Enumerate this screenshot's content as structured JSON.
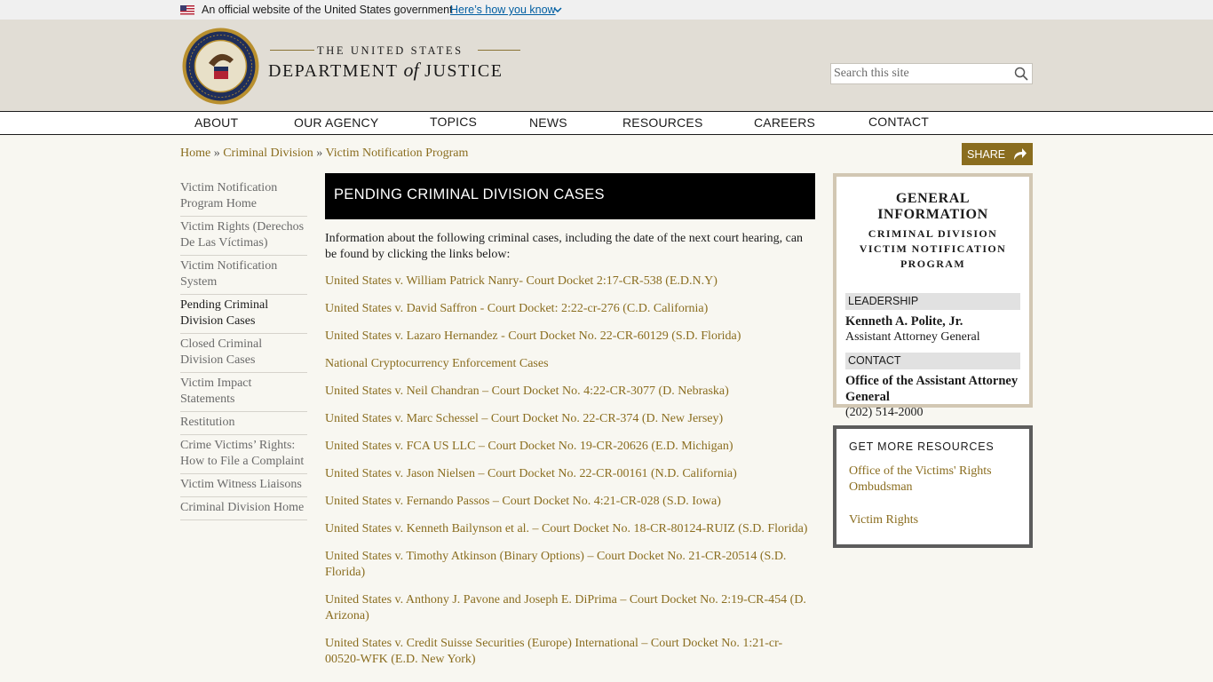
{
  "gov_banner": {
    "official_text": "An official website of the United States government",
    "how_link": "Here’s how you know"
  },
  "header": {
    "united_states": "THE UNITED STATES",
    "department_pre": "DEPARTMENT ",
    "department_of": "of",
    "department_post": " JUSTICE",
    "search_placeholder": "Search this site"
  },
  "nav": {
    "items": [
      {
        "label": "ABOUT"
      },
      {
        "label": "OUR AGENCY"
      },
      {
        "label": "TOPICS"
      },
      {
        "label": "NEWS"
      },
      {
        "label": "RESOURCES"
      },
      {
        "label": "CAREERS"
      },
      {
        "label": "CONTACT"
      }
    ]
  },
  "breadcrumb": {
    "items": [
      "Home",
      "Criminal Division",
      "Victim Notification Program"
    ],
    "separator": "»"
  },
  "share_label": "SHARE",
  "sidebar": {
    "items": [
      {
        "label": "Victim Notification Program Home"
      },
      {
        "label": "Victim Rights (Derechos De Las Víctimas)"
      },
      {
        "label": "Victim Notification System"
      },
      {
        "label": "Pending Criminal Division Cases"
      },
      {
        "label": "Closed Criminal Division Cases"
      },
      {
        "label": "Victim Impact Statements"
      },
      {
        "label": "Restitution"
      },
      {
        "label": "Crime Victims’ Rights: How to File a Complaint"
      },
      {
        "label": "Victim Witness Liaisons"
      },
      {
        "label": "Criminal Division Home"
      }
    ]
  },
  "main": {
    "title": "PENDING CRIMINAL DIVISION CASES",
    "intro": "Information about the following criminal cases, including the date of the next court hearing, can be found by clicking the links below:",
    "cases": [
      "United States v. William Patrick Nanry- Court Docket 2:17-CR-538 (E.D.N.Y)",
      "United States v. David Saffron - Court Docket: 2:22-cr-276 (C.D. California)",
      "United States v. Lazaro Hernandez - Court Docket No. 22-CR-60129 (S.D. Florida)",
      "National Cryptocurrency Enforcement Cases",
      "United States v. Neil Chandran – Court Docket No. 4:22-CR-3077 (D. Nebraska)",
      "United States v. Marc Schessel – Court Docket No. 22-CR-374 (D. New Jersey)",
      "United States v. FCA US LLC – Court Docket No. 19-CR-20626 (E.D. Michigan)",
      "United States v. Jason Nielsen – Court Docket No. 22-CR-00161 (N.D. California)",
      "United States v. Fernando Passos – Court Docket No. 4:21-CR-028 (S.D. Iowa)",
      "United States v. Kenneth Bailynson et al. – Court Docket No. 18-CR-80124-RUIZ (S.D. Florida)",
      "United States v. Timothy Atkinson (Binary Options) – Court Docket No. 21-CR-20514 (S.D. Florida)",
      "United States v. Anthony J. Pavone and Joseph E. DiPrima – Court Docket No. 2:19-CR-454 (D. Arizona)",
      "United States v. Credit Suisse Securities (Europe) International – Court Docket No. 1:21-cr-00520-WFK (E.D. New York)"
    ]
  },
  "info_box": {
    "title": "GENERAL INFORMATION",
    "subtitle": "CRIMINAL DIVISION VICTIM NOTIFICATION PROGRAM",
    "leadership_label": "LEADERSHIP",
    "leader_name": "Kenneth A. Polite, Jr.",
    "leader_role": "Assistant Attorney General",
    "contact_label": "CONTACT",
    "contact_name": "Office of the Assistant Attorney General",
    "contact_phone": "(202) 514-2000"
  },
  "resources": {
    "title": "GET MORE RESOURCES",
    "links": [
      "Office of the Victims' Rights Ombudsman",
      "Victim Rights"
    ]
  },
  "colors": {
    "link_gold": "#8a6d1f",
    "header_bg": "#e1ddd5",
    "page_bg": "#f8f7f1",
    "title_bar": "#000000"
  }
}
